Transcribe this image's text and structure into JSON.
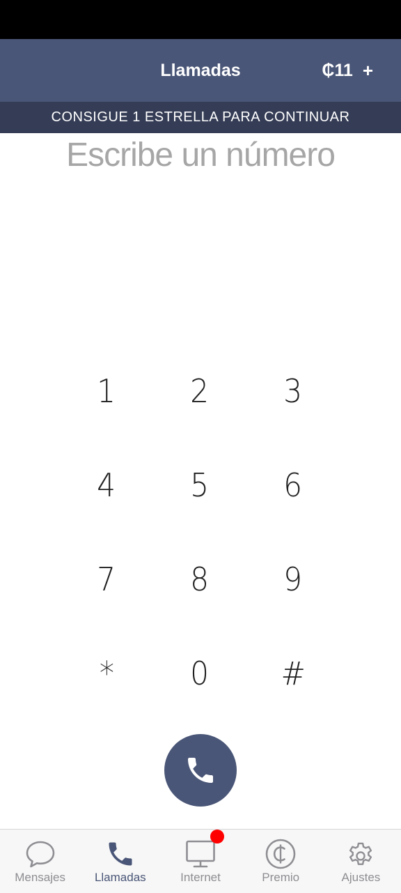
{
  "header": {
    "title": "Llamadas",
    "credit": "₵11",
    "add_label": "+"
  },
  "banner": {
    "text": "CONSIGUE 1 ESTRELLA PARA CONTINUAR"
  },
  "dialer": {
    "placeholder": "Escribe un número",
    "value": "",
    "keys": [
      "1",
      "2",
      "3",
      "4",
      "5",
      "6",
      "7",
      "8",
      "9",
      "*",
      "0",
      "#"
    ]
  },
  "tabs": [
    {
      "label": "Mensajes",
      "icon": "chat-bubble-icon",
      "active": false
    },
    {
      "label": "Llamadas",
      "icon": "phone-icon",
      "active": true
    },
    {
      "label": "Internet",
      "icon": "monitor-icon",
      "active": false,
      "badge": true
    },
    {
      "label": "Premio",
      "icon": "coin-icon",
      "active": false
    },
    {
      "label": "Ajustes",
      "icon": "gear-icon",
      "active": false
    }
  ],
  "colors": {
    "header": "#4a5677",
    "banner": "#353d56",
    "call_button": "#4a5677",
    "tab_active": "#4a5677",
    "tab_inactive": "#8e8e93",
    "badge": "#ff0000"
  }
}
